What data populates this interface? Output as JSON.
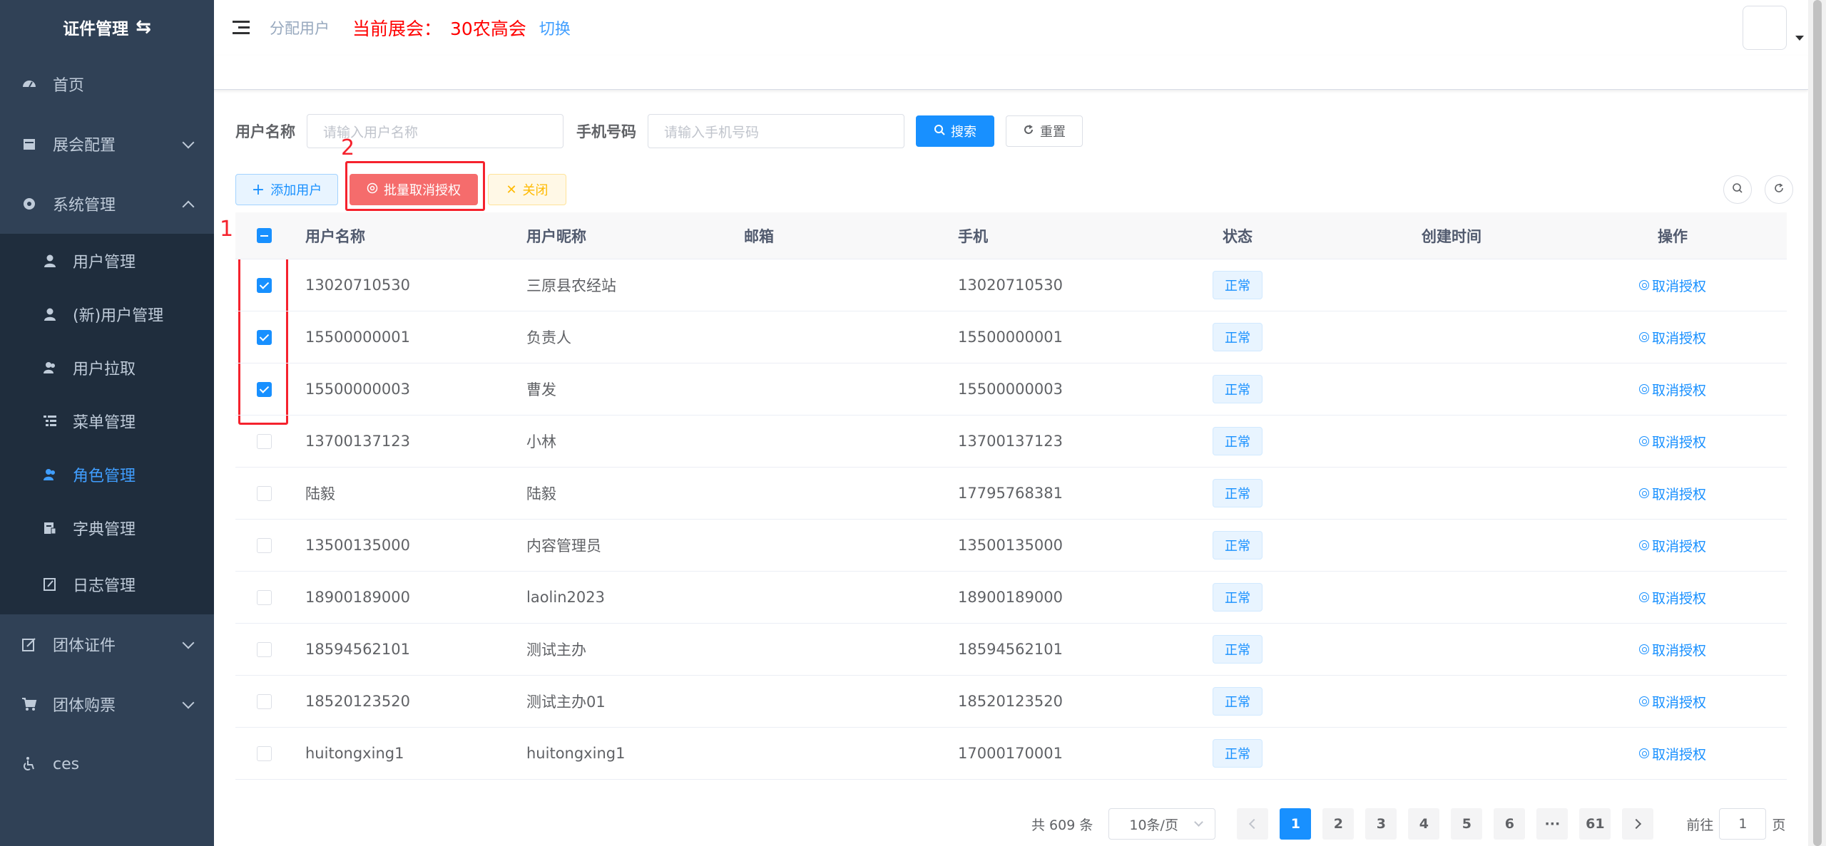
{
  "sidebar": {
    "brand": "证件管理",
    "items": [
      {
        "label": "首页"
      },
      {
        "label": "展会配置"
      },
      {
        "label": "系统管理"
      }
    ],
    "system_sub": [
      {
        "label": "用户管理"
      },
      {
        "label": "(新)用户管理"
      },
      {
        "label": "用户拉取"
      },
      {
        "label": "菜单管理"
      },
      {
        "label": "角色管理"
      },
      {
        "label": "字典管理"
      },
      {
        "label": "日志管理"
      }
    ],
    "bottom_items": [
      {
        "label": "团体证件"
      },
      {
        "label": "团体购票"
      },
      {
        "label": "ces"
      }
    ]
  },
  "header": {
    "breadcrumb": "分配用户",
    "expo_label": "当前展会：",
    "expo_name": "30农高会",
    "switch_label": "切换"
  },
  "search": {
    "username_label": "用户名称",
    "username_placeholder": "请输入用户名称",
    "phone_label": "手机号码",
    "phone_placeholder": "请输入手机号码",
    "search_btn": "搜索",
    "reset_btn": "重置"
  },
  "toolbar": {
    "add_btn": "添加用户",
    "batch_btn": "批量取消授权",
    "close_btn": "关闭"
  },
  "annotations": {
    "n1": "1",
    "n2": "2"
  },
  "table": {
    "headers": {
      "username": "用户名称",
      "nickname": "用户昵称",
      "email": "邮箱",
      "phone": "手机",
      "status": "状态",
      "created": "创建时间",
      "op": "操作"
    },
    "rows": [
      {
        "username": "13020710530",
        "nickname": "三原县农经站",
        "email": "",
        "phone": "13020710530",
        "status": "正常",
        "created": "",
        "op": "取消授权",
        "checked": true
      },
      {
        "username": "15500000001",
        "nickname": "负责人",
        "email": "",
        "phone": "15500000001",
        "status": "正常",
        "created": "",
        "op": "取消授权",
        "checked": true
      },
      {
        "username": "15500000003",
        "nickname": "曹发",
        "email": "",
        "phone": "15500000003",
        "status": "正常",
        "created": "",
        "op": "取消授权",
        "checked": true
      },
      {
        "username": "13700137123",
        "nickname": "小林",
        "email": "",
        "phone": "13700137123",
        "status": "正常",
        "created": "",
        "op": "取消授权",
        "checked": false
      },
      {
        "username": "陆毅",
        "nickname": "陆毅",
        "email": "",
        "phone": "17795768381",
        "status": "正常",
        "created": "",
        "op": "取消授权",
        "checked": false
      },
      {
        "username": "13500135000",
        "nickname": "内容管理员",
        "email": "",
        "phone": "13500135000",
        "status": "正常",
        "created": "",
        "op": "取消授权",
        "checked": false
      },
      {
        "username": "18900189000",
        "nickname": "laolin2023",
        "email": "",
        "phone": "18900189000",
        "status": "正常",
        "created": "",
        "op": "取消授权",
        "checked": false
      },
      {
        "username": "18594562101",
        "nickname": "测试主办",
        "email": "",
        "phone": "18594562101",
        "status": "正常",
        "created": "",
        "op": "取消授权",
        "checked": false
      },
      {
        "username": "18520123520",
        "nickname": "测试主办01",
        "email": "",
        "phone": "18520123520",
        "status": "正常",
        "created": "",
        "op": "取消授权",
        "checked": false
      },
      {
        "username": "huitongxing1",
        "nickname": "huitongxing1",
        "email": "",
        "phone": "17000170001",
        "status": "正常",
        "created": "",
        "op": "取消授权",
        "checked": false
      }
    ]
  },
  "pagination": {
    "total": "共 609 条",
    "page_size": "10条/页",
    "pages": [
      "1",
      "2",
      "3",
      "4",
      "5",
      "6",
      "···",
      "61"
    ],
    "current": "1",
    "goto_label": "前往",
    "goto_value": "1",
    "page_suffix": "页"
  },
  "colors": {
    "sidebar_bg": "#304156",
    "submenu_bg": "#1f2d3d",
    "primary": "#1890ff",
    "danger": "#f56c6c",
    "highlight": "#f5222d"
  }
}
